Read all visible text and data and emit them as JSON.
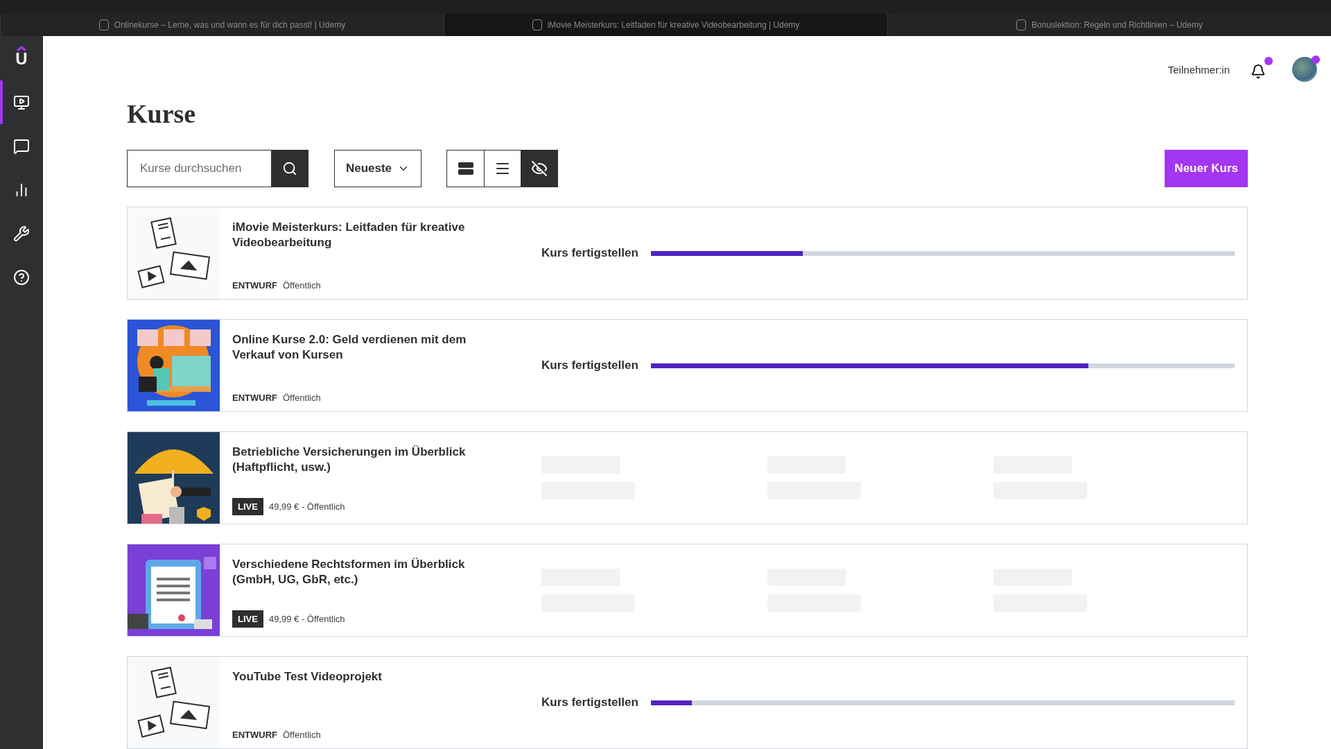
{
  "browser_tabs": [
    {
      "title": "Onlinekurse – Lerne, was und wann es für dich passt! | Udemy",
      "selected": false
    },
    {
      "title": "iMovie Meisterkurs: Leitfaden für kreative Videobearbeitung | Udemy",
      "selected": true
    },
    {
      "title": "Bonuslektion: Regeln und Richtlinien – Udemy",
      "selected": false
    }
  ],
  "sidebar": {
    "logo": "U",
    "items": [
      {
        "kind": "courses",
        "selected": true
      },
      {
        "kind": "messages",
        "selected": false
      },
      {
        "kind": "performance",
        "selected": false
      },
      {
        "kind": "tools",
        "selected": false
      },
      {
        "kind": "help",
        "selected": false
      }
    ]
  },
  "header": {
    "role_link": "Teilnehmer:in",
    "notifications_unread": true,
    "avatar_unread": true
  },
  "page_title": "Kurse",
  "toolbar": {
    "search": {
      "placeholder": "Kurse durchsuchen"
    },
    "sort": "Neueste",
    "views": [
      {
        "kind": "cards",
        "selected": false
      },
      {
        "kind": "list",
        "selected": false
      },
      {
        "kind": "hidden",
        "selected": true
      }
    ],
    "new_course": "Neuer Kurs"
  },
  "courses": [
    {
      "kind": "draft",
      "thumbnail": {
        "kind": "placeholder"
      },
      "title": "iMovie Meisterkurs: Leitfaden für kreative Videobearbeitung",
      "status": "ENTWURF",
      "visibility": "Öffentlich",
      "progress_label": "Kurs fertigstellen",
      "level": 0.26
    },
    {
      "kind": "draft",
      "title": "Online Kurse 2.0: Geld verdienen mit dem Verkauf von Kursen",
      "status": "ENTWURF",
      "visibility": "Öffentlich",
      "progress_label": "Kurs fertigstellen",
      "level": 0.75
    },
    {
      "kind": "live",
      "title": "Betriebliche Versicherungen im Überblick (Haftpflicht, usw.)",
      "status": "LIVE",
      "visibility": "49,99 € - Öffentlich"
    },
    {
      "kind": "live",
      "title": "Verschiedene Rechtsformen im Überblick (GmbH, UG, GbR, etc.)",
      "status": "LIVE",
      "visibility": "49,99 € - Öffentlich"
    },
    {
      "kind": "draft",
      "thumbnail": {
        "kind": "placeholder"
      },
      "title": "YouTube Test Videoprojekt",
      "status": "ENTWURF",
      "visibility": "Öffentlich",
      "progress_label": "Kurs fertigstellen",
      "level": 0.07
    }
  ]
}
